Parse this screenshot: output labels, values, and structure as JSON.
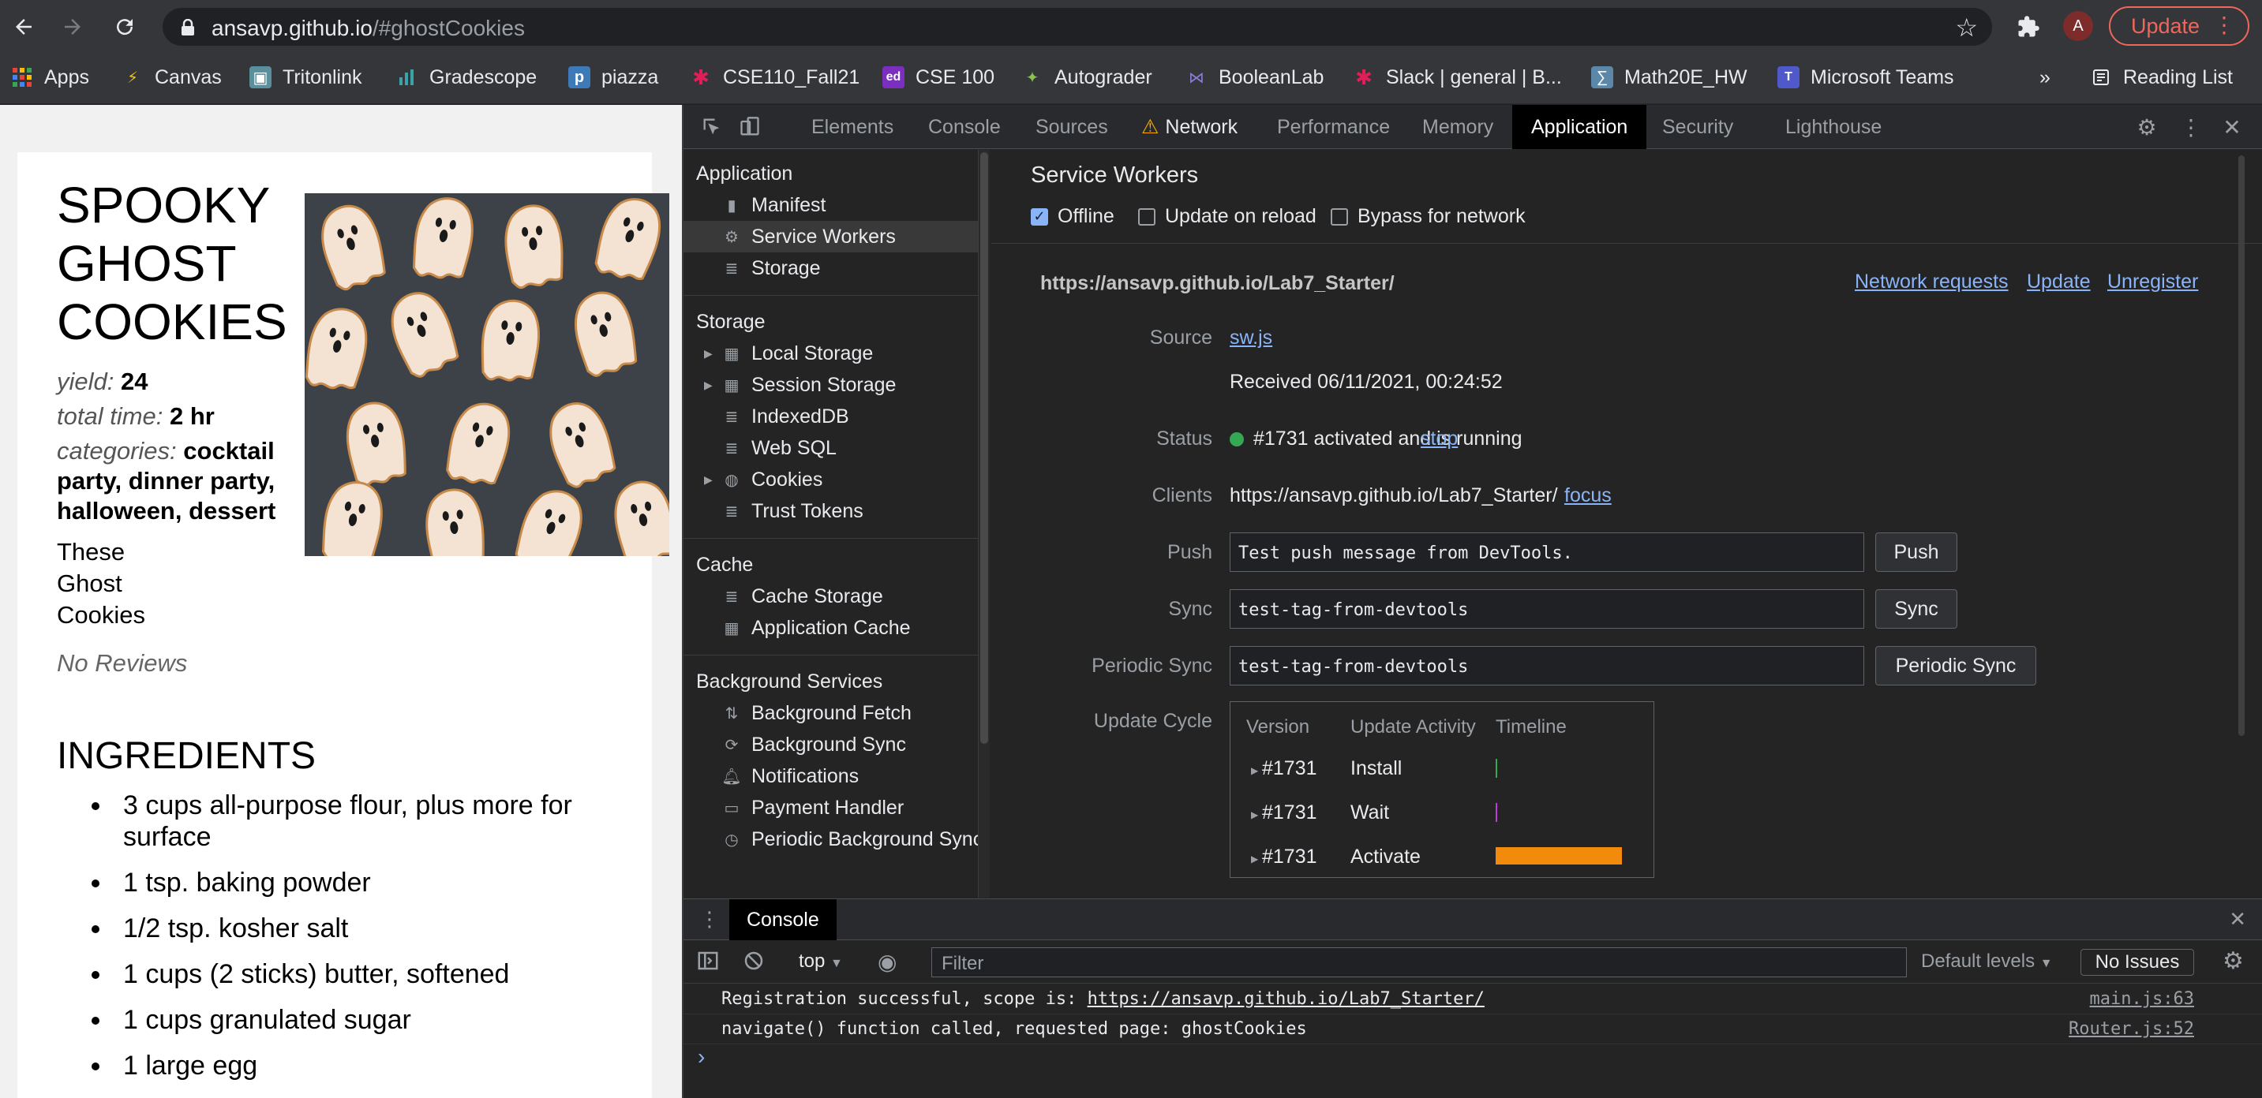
{
  "browser": {
    "url_host": "ansavp.github.io",
    "url_path": "/#ghostCookies",
    "avatar_letter": "A",
    "update_label": "Update"
  },
  "bookmarks": [
    {
      "label": "Apps",
      "icon": "apps-grid-icon"
    },
    {
      "label": "Canvas",
      "icon": "canvas-icon"
    },
    {
      "label": "Tritonlink",
      "icon": "tritonlink-icon"
    },
    {
      "label": "Gradescope",
      "icon": "gradescope-icon"
    },
    {
      "label": "piazza",
      "icon": "piazza-icon"
    },
    {
      "label": "CSE110_Fall21",
      "icon": "slack-icon"
    },
    {
      "label": "CSE 100",
      "icon": "edstem-icon"
    },
    {
      "label": "Autograder",
      "icon": "autograder-icon"
    },
    {
      "label": "BooleanLab",
      "icon": "booleanlab-icon"
    },
    {
      "label": "Slack | general | B...",
      "icon": "slack-icon"
    },
    {
      "label": "Math20E_HW",
      "icon": "math-icon"
    },
    {
      "label": "Microsoft Teams",
      "icon": "teams-icon"
    }
  ],
  "bookmarks_overflow": "»",
  "reading_list": "Reading List",
  "recipe": {
    "title_lines": [
      "SPOOKY",
      "GHOST",
      "COOKIES"
    ],
    "yield_label": "yield:",
    "yield_value": "24",
    "time_label": "total time:",
    "time_value": "2 hr",
    "categories_label": "categories:",
    "categories_value_1": "cocktail",
    "categories_value_2": "party, dinner party,",
    "categories_value_3": "halloween, dessert",
    "description_lines": [
      "These",
      "Ghost",
      "Cookies"
    ],
    "reviews": "No Reviews",
    "ingredients_title": "INGREDIENTS",
    "ingredients": [
      "3 cups all-purpose flour, plus more for surface",
      "1 tsp. baking powder",
      "1/2 tsp. kosher salt",
      "1 cups (2 sticks) butter, softened",
      "1 cups granulated sugar",
      "1 large egg"
    ]
  },
  "devtools": {
    "tabs": [
      "Elements",
      "Console",
      "Sources",
      "Network",
      "Performance",
      "Memory",
      "Application",
      "Security",
      "Lighthouse"
    ],
    "active_tab": "Application",
    "sidebar": {
      "application_header": "Application",
      "application_items": [
        "Manifest",
        "Service Workers",
        "Storage"
      ],
      "storage_header": "Storage",
      "storage_items": [
        "Local Storage",
        "Session Storage",
        "IndexedDB",
        "Web SQL",
        "Cookies",
        "Trust Tokens"
      ],
      "cache_header": "Cache",
      "cache_items": [
        "Cache Storage",
        "Application Cache"
      ],
      "bg_header": "Background Services",
      "bg_items": [
        "Background Fetch",
        "Background Sync",
        "Notifications",
        "Payment Handler",
        "Periodic Background Sync"
      ]
    },
    "sw": {
      "title": "Service Workers",
      "offline": "Offline",
      "update_on_reload": "Update on reload",
      "bypass": "Bypass for network",
      "scope": "https://ansavp.github.io/Lab7_Starter/",
      "network_requests": "Network requests",
      "update": "Update",
      "unregister": "Unregister",
      "source_label": "Source",
      "source_file": "sw.js",
      "received": "Received 06/11/2021, 00:24:52",
      "status_label": "Status",
      "status_text": "#1731 activated and is running",
      "stop": "stop",
      "clients_label": "Clients",
      "clients_url": "https://ansavp.github.io/Lab7_Starter/",
      "focus": "focus",
      "push_label": "Push",
      "push_value": "Test push message from DevTools.",
      "push_btn": "Push",
      "sync_label": "Sync",
      "sync_value": "test-tag-from-devtools",
      "sync_btn": "Sync",
      "periodic_label": "Periodic Sync",
      "periodic_value": "test-tag-from-devtools",
      "periodic_btn": "Periodic Sync",
      "cycle_label": "Update Cycle",
      "cycle_headers": [
        "Version",
        "Update Activity",
        "Timeline"
      ],
      "cycle_rows": [
        {
          "version": "#1731",
          "activity": "Install",
          "color": "#34a853"
        },
        {
          "version": "#1731",
          "activity": "Wait",
          "color": "#c13bd6"
        },
        {
          "version": "#1731",
          "activity": "Activate",
          "color": "#f28b0c"
        }
      ]
    },
    "console": {
      "tab": "Console",
      "context": "top",
      "filter_placeholder": "Filter",
      "levels": "Default levels",
      "issues": "No Issues",
      "logs": [
        {
          "prefix": "Registration successful, scope is: ",
          "link": "https://ansavp.github.io/Lab7_Starter/",
          "source": "main.js:63"
        },
        {
          "prefix": "navigate() function called, requested page: ghostCookies",
          "link": "",
          "source": "Router.js:52"
        }
      ],
      "prompt": "›"
    }
  }
}
